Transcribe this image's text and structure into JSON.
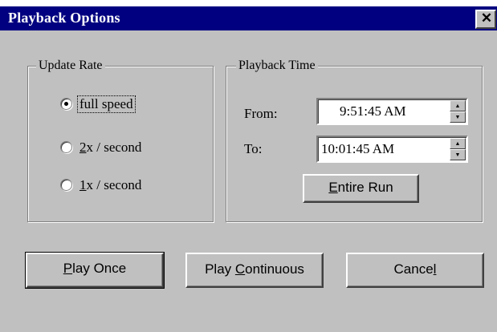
{
  "window": {
    "title": "Playback Options",
    "close_glyph": "✕"
  },
  "update_rate": {
    "legend": "Update Rate",
    "options": [
      {
        "label": "full speed",
        "mnemonic": "",
        "rest": "full speed",
        "selected": true
      },
      {
        "label": "2x / second",
        "mnemonic": "2",
        "rest": "x / second",
        "selected": false
      },
      {
        "label": "1x / second",
        "mnemonic": "1",
        "rest": "x / second",
        "selected": false
      }
    ]
  },
  "playback_time": {
    "legend": "Playback Time",
    "from_label": "From:",
    "from_value": "9:51:45 AM",
    "to_label": "To:",
    "to_value": "10:01:45 AM",
    "spin_up_icon": "triangle-up",
    "spin_down_icon": "triangle-down",
    "entire_run": {
      "mnemonic": "E",
      "rest": "ntire Run"
    }
  },
  "buttons": {
    "play_once": {
      "mnemonic": "P",
      "rest": "lay Once"
    },
    "play_continuous": {
      "before": "Play ",
      "mnemonic": "C",
      "rest": "ontinuous"
    },
    "cancel": {
      "before": "Cance",
      "mnemonic": "l",
      "rest": ""
    }
  },
  "colors": {
    "titlebar": "#000080",
    "face": "#c0c0c0"
  }
}
